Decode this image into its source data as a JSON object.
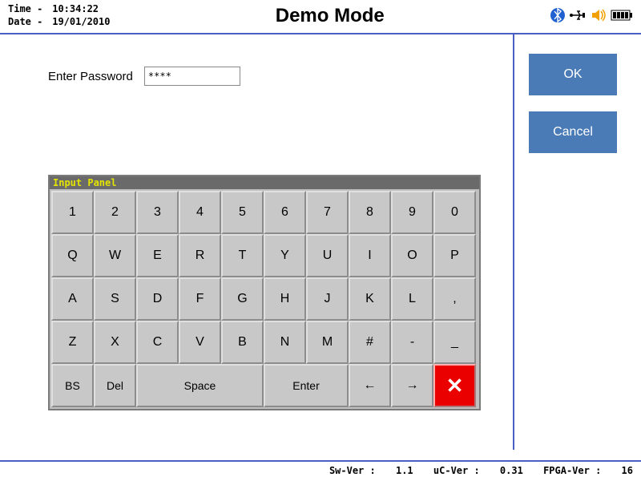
{
  "header": {
    "time_label": "Time -",
    "time_value": "10:34:22",
    "date_label": "Date -",
    "date_value": "19/01/2010",
    "title": "Demo Mode"
  },
  "prompt": {
    "label": "Enter Password",
    "value": "****"
  },
  "sidebar": {
    "ok": "OK",
    "cancel": "Cancel"
  },
  "keyboard": {
    "title": "Input Panel",
    "row1": [
      "1",
      "2",
      "3",
      "4",
      "5",
      "6",
      "7",
      "8",
      "9",
      "0"
    ],
    "row2": [
      "Q",
      "W",
      "E",
      "R",
      "T",
      "Y",
      "U",
      "I",
      "O",
      "P"
    ],
    "row3": [
      "A",
      "S",
      "D",
      "F",
      "G",
      "H",
      "J",
      "K",
      "L",
      ","
    ],
    "row4": [
      "Z",
      "X",
      "C",
      "V",
      "B",
      "N",
      "M",
      "#",
      "-",
      "_"
    ],
    "bs": "BS",
    "del": "Del",
    "space": "Space",
    "enter": "Enter",
    "left": "←",
    "right": "→",
    "close": "✕"
  },
  "footer": {
    "sw_label": "Sw-Ver :",
    "sw_val": "1.1",
    "uc_label": "uC-Ver :",
    "uc_val": "0.31",
    "fpga_label": "FPGA-Ver :",
    "fpga_val": "16"
  }
}
